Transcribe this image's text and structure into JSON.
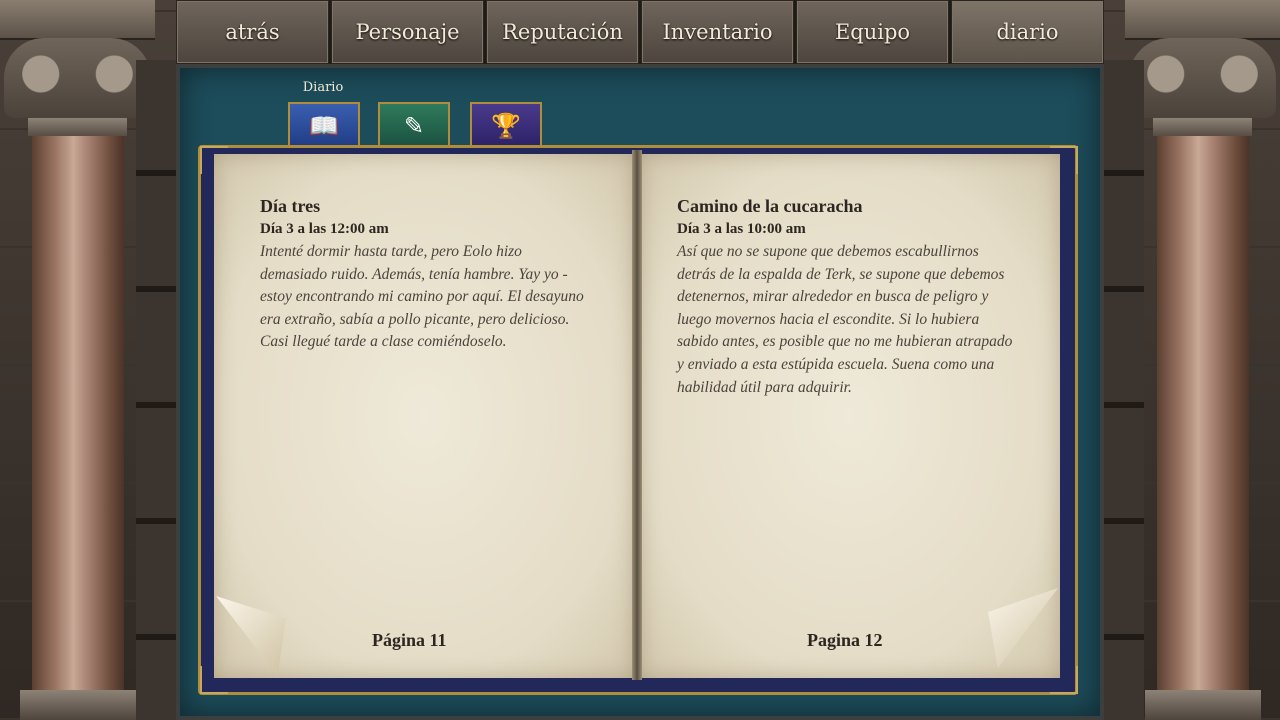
{
  "nav": {
    "tabs": [
      {
        "label": "atrás"
      },
      {
        "label": "Personaje"
      },
      {
        "label": "Reputación"
      },
      {
        "label": "Inventario"
      },
      {
        "label": "Equipo"
      },
      {
        "label": "diario"
      }
    ],
    "active": "diario"
  },
  "section_label": "Diario",
  "category_icons": [
    "book-icon",
    "scroll-quill-icon",
    "trophy-icon"
  ],
  "left_page": {
    "title": "Día tres",
    "time": "Día 3 a las 12:00 am",
    "body_lines": [
      "Intenté dormir hasta tarde, pero Eolo hizo",
      "demasiado ruido. Además, tenía hambre. Yay yo -",
      "estoy encontrando mi camino por aquí. El desayuno",
      "era extraño, sabía a pollo picante, pero delicioso.",
      "Casi llegué tarde a clase comiéndoselo."
    ],
    "page_number": "Página 11"
  },
  "right_page": {
    "title": "Camino de la cucaracha",
    "time": "Día 3 a las 10:00 am",
    "body_lines": [
      "Así que no se supone que debemos escabullirnos",
      "detrás de la espalda de Terk, se supone que debemos",
      "detenernos, mirar alrededor en busca de peligro y",
      "luego movernos hacia el escondite. Si lo hubiera",
      "sabido antes, es posible que no me hubieran atrapado",
      "y enviado a esta estúpida escuela. Suena como una",
      "habilidad útil para adquirir."
    ],
    "page_number": "Pagina 12"
  },
  "colors": {
    "panel": "#1d4c5a",
    "book_cover": "#23285a",
    "gold_trim": "#b08d3a",
    "parchment": "#e9e2cf"
  }
}
